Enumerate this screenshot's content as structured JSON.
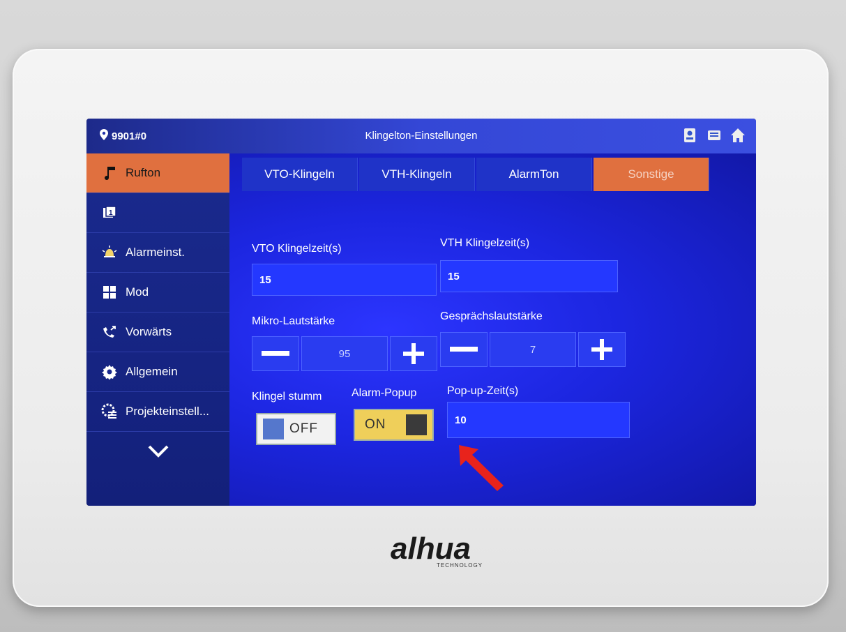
{
  "topbar": {
    "location": "9901#0",
    "title": "Klingelton-Einstellungen",
    "icons": [
      "intercom-icon",
      "message-icon",
      "home-icon"
    ]
  },
  "sidebar": {
    "items": [
      {
        "label": "Rufton",
        "icon": "music-note-icon",
        "active": true
      },
      {
        "label": "",
        "icon": "monitor-icon",
        "active": false
      },
      {
        "label": "Alarmeinst.",
        "icon": "alarm-bell-icon",
        "active": false
      },
      {
        "label": "Mod",
        "icon": "grid-icon",
        "active": false
      },
      {
        "label": "Vorwärts",
        "icon": "call-forward-icon",
        "active": false
      },
      {
        "label": "Allgemein",
        "icon": "gear-icon",
        "active": false
      },
      {
        "label": "Projekteinstell...",
        "icon": "project-settings-icon",
        "active": false
      }
    ],
    "more_icon": "chevron-down-icon"
  },
  "tabs": [
    {
      "label": "VTO-Klingeln",
      "active": false
    },
    {
      "label": "VTH-Klingeln",
      "active": false
    },
    {
      "label": "AlarmTon",
      "active": false
    },
    {
      "label": "Sonstige",
      "active": true
    }
  ],
  "form": {
    "vto_ring_label": "VTO Klingelzeit(s)",
    "vto_ring_value": "15",
    "vth_ring_label": "VTH Klingelzeit(s)",
    "vth_ring_value": "15",
    "mic_label": "Mikro-Lautstärke",
    "mic_value": "95",
    "talk_label": "Gesprächslautstärke",
    "talk_value": "7",
    "mute_label": "Klingel stumm",
    "mute_state": "OFF",
    "popup_label": "Alarm-Popup",
    "popup_state": "ON",
    "popup_time_label": "Pop-up-Zeit(s)",
    "popup_time_value": "10"
  },
  "brand": {
    "name": "alhua",
    "sub": "TECHNOLOGY"
  },
  "colors": {
    "accent": "#e0703f",
    "screen_blue": "#1c26e0",
    "toggle_on": "#efcf5a",
    "arrow": "#e8231c"
  }
}
